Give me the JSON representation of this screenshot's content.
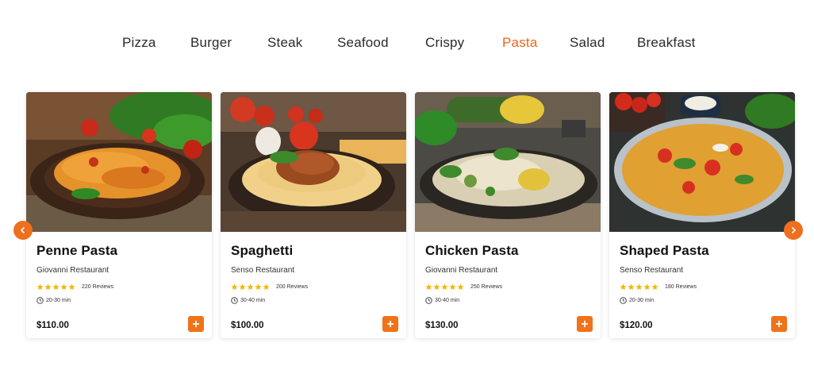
{
  "categories": {
    "items": [
      "Pizza",
      "Burger",
      "Steak",
      "Seafood",
      "Crispy",
      "Pasta",
      "Salad",
      "Breakfast"
    ],
    "active": "Pasta"
  },
  "colors": {
    "accent": "#e8661c",
    "button": "#f07219",
    "star": "#f5b400"
  },
  "carousel": {
    "prev_icon": "chevron-left-icon",
    "next_icon": "chevron-right-icon"
  },
  "cards": [
    {
      "name": "Penne Pasta",
      "restaurant": "Giovanni Restaurant",
      "stars": 5,
      "reviews": "220 Reviews",
      "time": "20-30 min",
      "price": "$110.00"
    },
    {
      "name": "Spaghetti",
      "restaurant": "Senso Restaurant",
      "stars": 5,
      "reviews": "200 Reviews",
      "time": "30-40 min",
      "price": "$100.00"
    },
    {
      "name": "Chicken Pasta",
      "restaurant": "Giovanni Restaurant",
      "stars": 5,
      "reviews": "250 Reviews",
      "time": "30-40 min",
      "price": "$130.00"
    },
    {
      "name": "Shaped Pasta",
      "restaurant": "Senso Restaurant",
      "stars": 5,
      "reviews": "180 Reviews",
      "time": "20-30 min",
      "price": "$120.00"
    }
  ]
}
